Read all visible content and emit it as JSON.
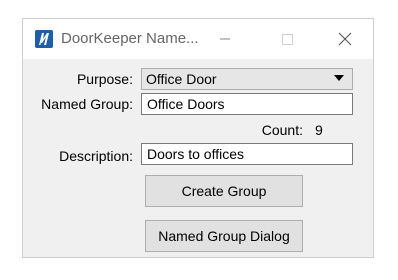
{
  "window": {
    "title": "DoorKeeper Name..."
  },
  "form": {
    "purpose_label": "Purpose:",
    "purpose_value": "Office Door",
    "named_group_label": "Named Group:",
    "named_group_value": "Office Doors",
    "count_label": "Count:",
    "count_value": "9",
    "description_label": "Description:",
    "description_value": "Doors to offices"
  },
  "buttons": {
    "create_group": "Create Group",
    "named_group_dialog": "Named Group Dialog"
  },
  "icons": {
    "app": "microstation-logo-icon",
    "minimize": "minimize-icon",
    "maximize": "maximize-icon",
    "close": "close-icon",
    "dropdown": "chevron-down-icon"
  },
  "colors": {
    "app_icon_bg": "#1f5fa8",
    "window_bg": "#f0f0f0",
    "button_bg": "#e1e1e1"
  }
}
